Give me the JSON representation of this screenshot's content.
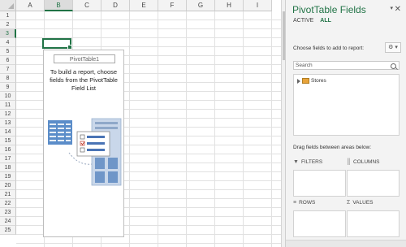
{
  "grid": {
    "columns": [
      "A",
      "B",
      "C",
      "D",
      "E",
      "F",
      "G",
      "H",
      "I"
    ],
    "selected_column": "B",
    "rows": [
      "1",
      "2",
      "3",
      "4",
      "5",
      "6",
      "7",
      "8",
      "9",
      "10",
      "11",
      "12",
      "13",
      "14",
      "15",
      "16",
      "17",
      "18",
      "19",
      "20",
      "21",
      "22",
      "23",
      "24",
      "25"
    ],
    "selected_row": "3"
  },
  "pivot": {
    "name": "PivotTable1",
    "message": "To build a report, choose fields from the PivotTable Field List"
  },
  "pane": {
    "title": "PivotTable Fields",
    "tabs": [
      {
        "label": "ACTIVE",
        "active": false
      },
      {
        "label": "ALL",
        "active": true
      }
    ],
    "choose_label": "Choose fields to add to report:",
    "search_placeholder": "Search",
    "fields": [
      {
        "label": "Stores"
      }
    ],
    "drag_label": "Drag fields between areas below:",
    "areas": [
      {
        "label": "FILTERS",
        "icon": "filter-icon"
      },
      {
        "label": "COLUMNS",
        "icon": "columns-icon"
      },
      {
        "label": "ROWS",
        "icon": "rows-icon"
      },
      {
        "label": "VALUES",
        "icon": "sigma-icon"
      }
    ],
    "accent_color": "#217346"
  }
}
